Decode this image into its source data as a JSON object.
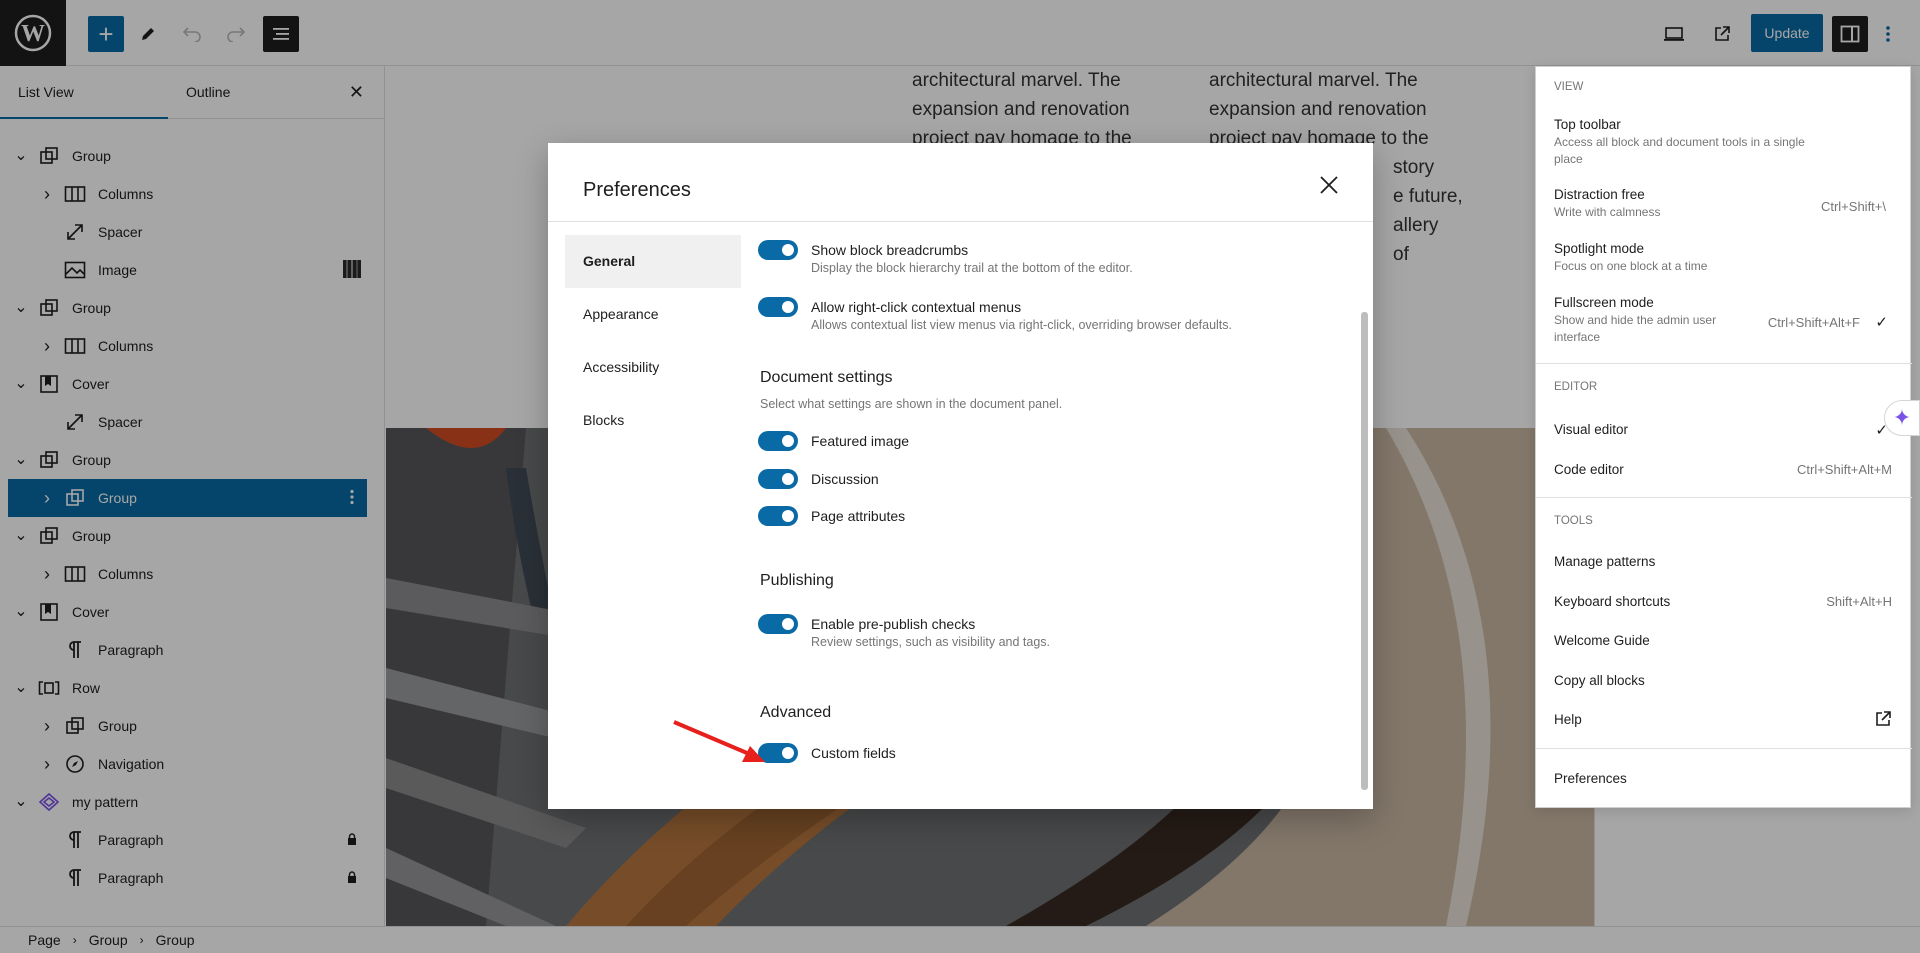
{
  "toolbar": {
    "update_label": "Update"
  },
  "sidebar": {
    "tabs": [
      "List View",
      "Outline"
    ],
    "items": [
      {
        "label": "Group",
        "icon": "group-icon",
        "expand": "down"
      },
      {
        "label": "Columns",
        "icon": "columns-icon",
        "expand": "right"
      },
      {
        "label": "Spacer",
        "icon": "spacer-icon",
        "expand": ""
      },
      {
        "label": "Image",
        "icon": "image-icon",
        "expand": ""
      },
      {
        "label": "Group",
        "icon": "group-icon",
        "expand": "down"
      },
      {
        "label": "Columns",
        "icon": "columns-icon",
        "expand": "right"
      },
      {
        "label": "Cover",
        "icon": "cover-icon",
        "expand": "down"
      },
      {
        "label": "Spacer",
        "icon": "spacer-icon",
        "expand": ""
      },
      {
        "label": "Group",
        "icon": "group-icon",
        "expand": "down"
      },
      {
        "label": "Group",
        "icon": "group-icon",
        "expand": "right",
        "selected": true
      },
      {
        "label": "Group",
        "icon": "group-icon",
        "expand": "down"
      },
      {
        "label": "Columns",
        "icon": "columns-icon",
        "expand": "right"
      },
      {
        "label": "Cover",
        "icon": "cover-icon",
        "expand": "down"
      },
      {
        "label": "Paragraph",
        "icon": "paragraph-icon",
        "expand": ""
      },
      {
        "label": "Row",
        "icon": "row-icon",
        "expand": "down"
      },
      {
        "label": "Group",
        "icon": "group-icon",
        "expand": "right"
      },
      {
        "label": "Navigation",
        "icon": "navigation-icon",
        "expand": "right"
      },
      {
        "label": "my pattern",
        "icon": "pattern-icon",
        "expand": "down"
      },
      {
        "label": "Paragraph",
        "icon": "paragraph-icon",
        "expand": "",
        "locked": true
      },
      {
        "label": "Paragraph",
        "icon": "paragraph-icon",
        "expand": "",
        "locked": true
      }
    ]
  },
  "breadcrumb": [
    "Page",
    "Group",
    "Group"
  ],
  "canvas": {
    "col1": [
      "architectural marvel. The",
      "expansion and renovation",
      "project pay homage to the"
    ],
    "col2": [
      "architectural marvel. The",
      "expansion and renovation",
      "project pay homage to the",
      "story",
      "e future,",
      "allery",
      "of"
    ]
  },
  "modal": {
    "title": "Preferences",
    "nav": [
      "General",
      "Appearance",
      "Accessibility",
      "Blocks"
    ],
    "breadcrumbs_label": "Show block breadcrumbs",
    "breadcrumbs_help": "Display the block hierarchy trail at the bottom of the editor.",
    "rightclick_label": "Allow right-click contextual menus",
    "rightclick_help": "Allows contextual list view menus via right-click, overriding browser defaults.",
    "doc_title": "Document settings",
    "doc_desc": "Select what settings are shown in the document panel.",
    "featured_label": "Featured image",
    "discussion_label": "Discussion",
    "attributes_label": "Page attributes",
    "publishing_title": "Publishing",
    "prepublish_label": "Enable pre-publish checks",
    "prepublish_help": "Review settings, such as visibility and tags.",
    "advanced_title": "Advanced",
    "customfields_label": "Custom fields"
  },
  "options_menu": {
    "view_heading": "VIEW",
    "top_toolbar": "Top toolbar",
    "top_toolbar_sub": "Access all block and document tools in a single place",
    "distraction": "Distraction free",
    "distraction_sub": "Write with calmness",
    "distraction_shortcut": "Ctrl+Shift+\\",
    "spotlight": "Spotlight mode",
    "spotlight_sub": "Focus on one block at a time",
    "fullscreen": "Fullscreen mode",
    "fullscreen_sub": "Show and hide the admin user interface",
    "fullscreen_shortcut": "Ctrl+Shift+Alt+F",
    "editor_heading": "EDITOR",
    "visual": "Visual editor",
    "code": "Code editor",
    "code_shortcut": "Ctrl+Shift+Alt+M",
    "tools_heading": "TOOLS",
    "manage_patterns": "Manage patterns",
    "keyboard": "Keyboard shortcuts",
    "keyboard_shortcut": "Shift+Alt+H",
    "welcome": "Welcome Guide",
    "copy_all": "Copy all blocks",
    "help": "Help",
    "preferences": "Preferences"
  },
  "colors": {
    "accent": "#0a6aa5",
    "arrow": "#e8201c",
    "pattern": "#7b52e8"
  }
}
